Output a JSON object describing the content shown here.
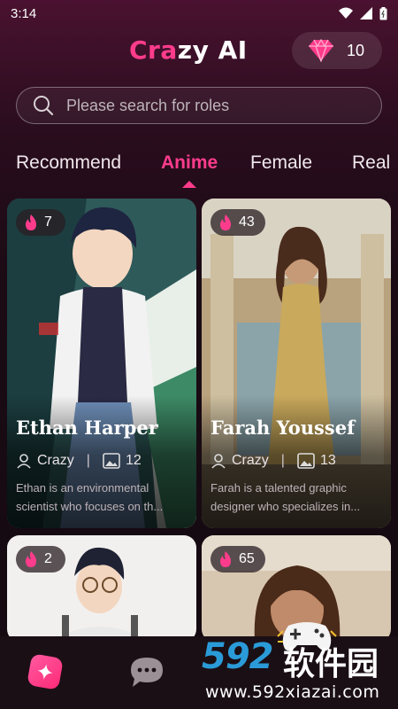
{
  "status_bar": {
    "time": "3:14"
  },
  "header": {
    "brand_pink": "Cra",
    "brand_white": "zy AI",
    "gem_count": "10"
  },
  "search": {
    "placeholder": "Please search for roles"
  },
  "tabs": [
    {
      "label": "Recommend",
      "active": false
    },
    {
      "label": "Anime",
      "active": true
    },
    {
      "label": "Female",
      "active": false
    },
    {
      "label": "Real",
      "active": false
    }
  ],
  "cards": [
    {
      "hot": "7",
      "name": "Ethan Harper",
      "author": "Crazy",
      "images": "12",
      "desc_line1": "Ethan is an environmental",
      "desc_line2": "scientist who focuses on th..."
    },
    {
      "hot": "43",
      "name": "Farah Youssef",
      "author": "Crazy",
      "images": "13",
      "desc_line1": "Farah is a talented graphic",
      "desc_line2": "designer who specializes in..."
    },
    {
      "hot": "2"
    },
    {
      "hot": "65"
    }
  ],
  "watermark": {
    "number": "592",
    "chinese": "软件园",
    "url": "www.592xiazai.com"
  },
  "colors": {
    "accent": "#ff3c8c",
    "background": "#1a0b14"
  }
}
